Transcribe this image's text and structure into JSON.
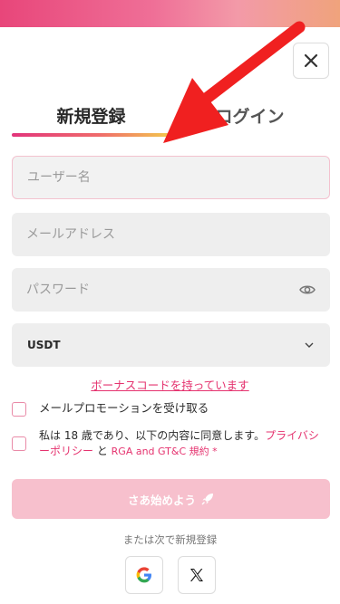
{
  "tabs": {
    "register": "新規登録",
    "login": "ログイン"
  },
  "form": {
    "username_placeholder": "ユーザー名",
    "email_placeholder": "メールアドレス",
    "password_placeholder": "パスワード",
    "currency": "USDT"
  },
  "bonus_code_link": "ボーナスコードを持っています",
  "promo_label": "メールプロモーションを受け取る",
  "terms": {
    "prefix": "私は 18 歳であり、以下の内容に同意します。",
    "privacy_link": "プライバシーポリシー",
    "and": " と ",
    "rga_link": "RGA and GT&C 規約",
    "asterisk": " *"
  },
  "submit_label": "さあ始めよう",
  "alt_signup_text": "または次で新規登録",
  "icons": {
    "close": "close-icon",
    "eye": "eye-icon",
    "chevron": "chevron-down-icon",
    "rocket": "rocket-icon",
    "google": "google-icon",
    "x": "x-icon",
    "annotation": "red-arrow-icon"
  },
  "colors": {
    "accent_pink": "#e5336f",
    "button_disabled": "#f7c0cd",
    "annotation_red": "#f02020"
  }
}
